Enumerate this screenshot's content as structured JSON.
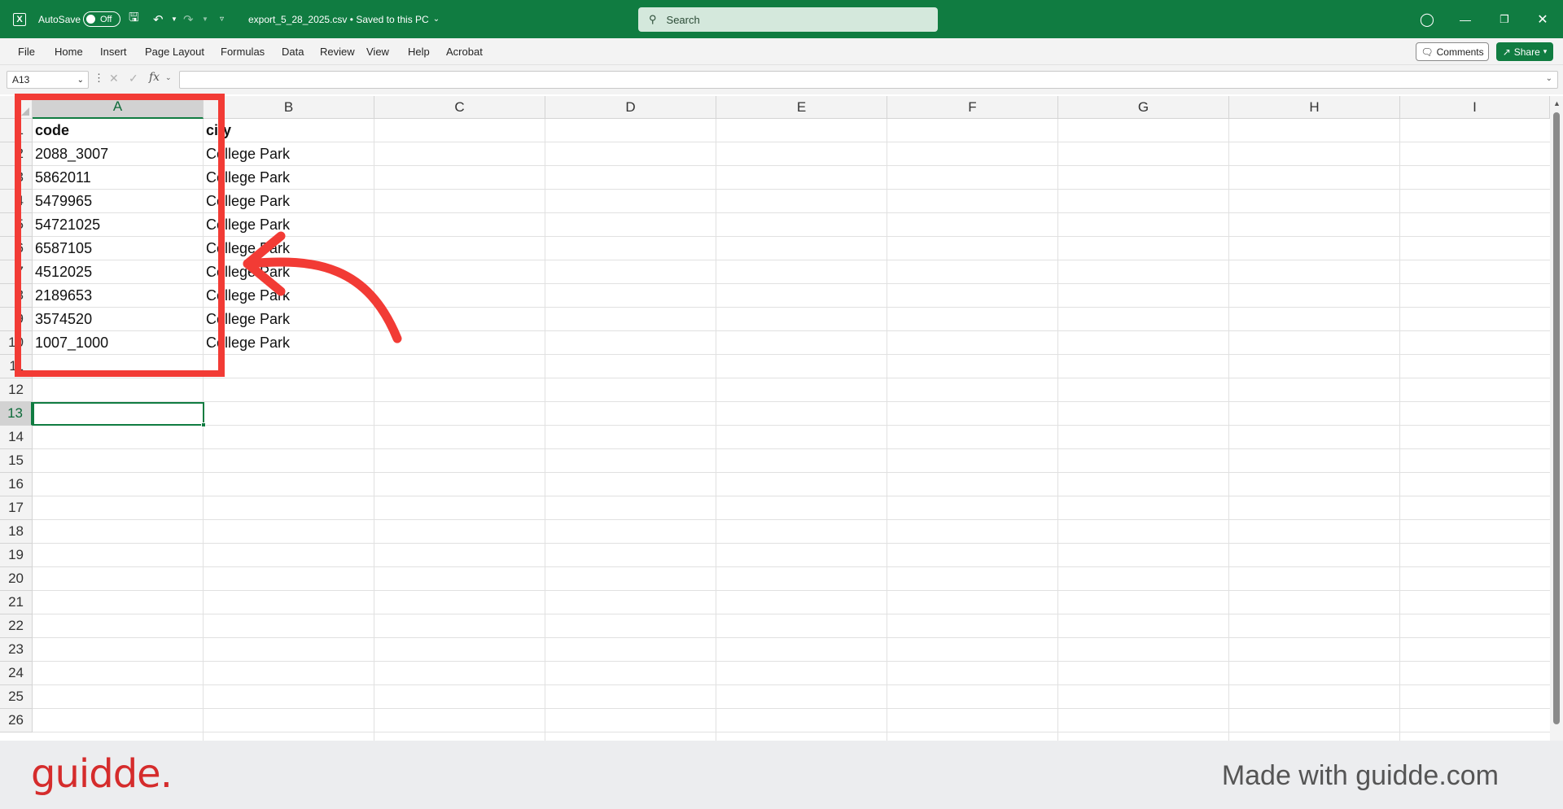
{
  "titlebar": {
    "autosave_label": "AutoSave",
    "autosave_state": "Off",
    "document_title": "export_5_28_2025.csv",
    "save_status": "•  Saved to this PC",
    "search_placeholder": "Search"
  },
  "ribbon": {
    "tabs": [
      "File",
      "Home",
      "Insert",
      "Page Layout",
      "Formulas",
      "Data",
      "Review",
      "View",
      "Help",
      "Acrobat"
    ],
    "comments_label": "Comments",
    "share_label": "Share"
  },
  "formula_bar": {
    "name_box": "A13",
    "fx_label": "fx",
    "formula": ""
  },
  "sheet": {
    "columns": [
      "A",
      "B",
      "C",
      "D",
      "E",
      "F",
      "G",
      "H",
      "I"
    ],
    "selected_column": "A",
    "rows": [
      "1",
      "2",
      "3",
      "4",
      "5",
      "6",
      "7",
      "8",
      "9",
      "10",
      "11",
      "12",
      "13",
      "14",
      "15",
      "16",
      "17",
      "18",
      "19",
      "20",
      "21",
      "22",
      "23",
      "24",
      "25",
      "26"
    ],
    "selected_row": "13",
    "header": [
      "code",
      "city"
    ],
    "data": [
      [
        "2088_3007",
        "College Park"
      ],
      [
        "5862011",
        "College Park"
      ],
      [
        "5479965",
        "College Park"
      ],
      [
        "54721025",
        "College Park"
      ],
      [
        "6587105",
        "College Park"
      ],
      [
        "4512025",
        "College Park"
      ],
      [
        "2189653",
        "College Park"
      ],
      [
        "3574520",
        "College Park"
      ],
      [
        "1007_1000",
        "College Park"
      ]
    ]
  },
  "annotation": {
    "color": "#f23b35"
  },
  "footer": {
    "brand": "guidde.",
    "made_with": "Made with guidde.com"
  }
}
